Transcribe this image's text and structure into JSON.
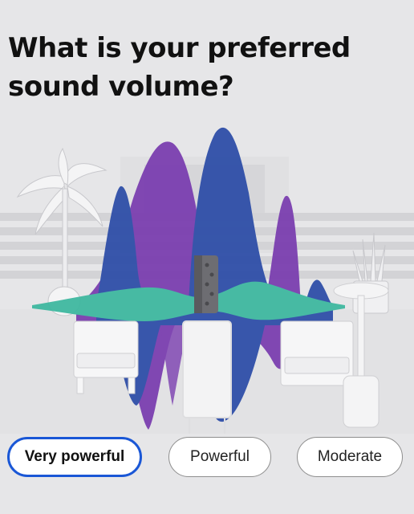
{
  "question": {
    "title": "What is your preferred sound volume?"
  },
  "options": [
    {
      "label": "Very powerful",
      "selected": true
    },
    {
      "label": "Powerful",
      "selected": false
    },
    {
      "label": "Moderate",
      "selected": false
    }
  ],
  "colors": {
    "accent": "#1a57d6",
    "wave_blue": "#2f4fa8",
    "wave_purple": "#7b3fb0",
    "wave_teal": "#3fb8a0"
  }
}
